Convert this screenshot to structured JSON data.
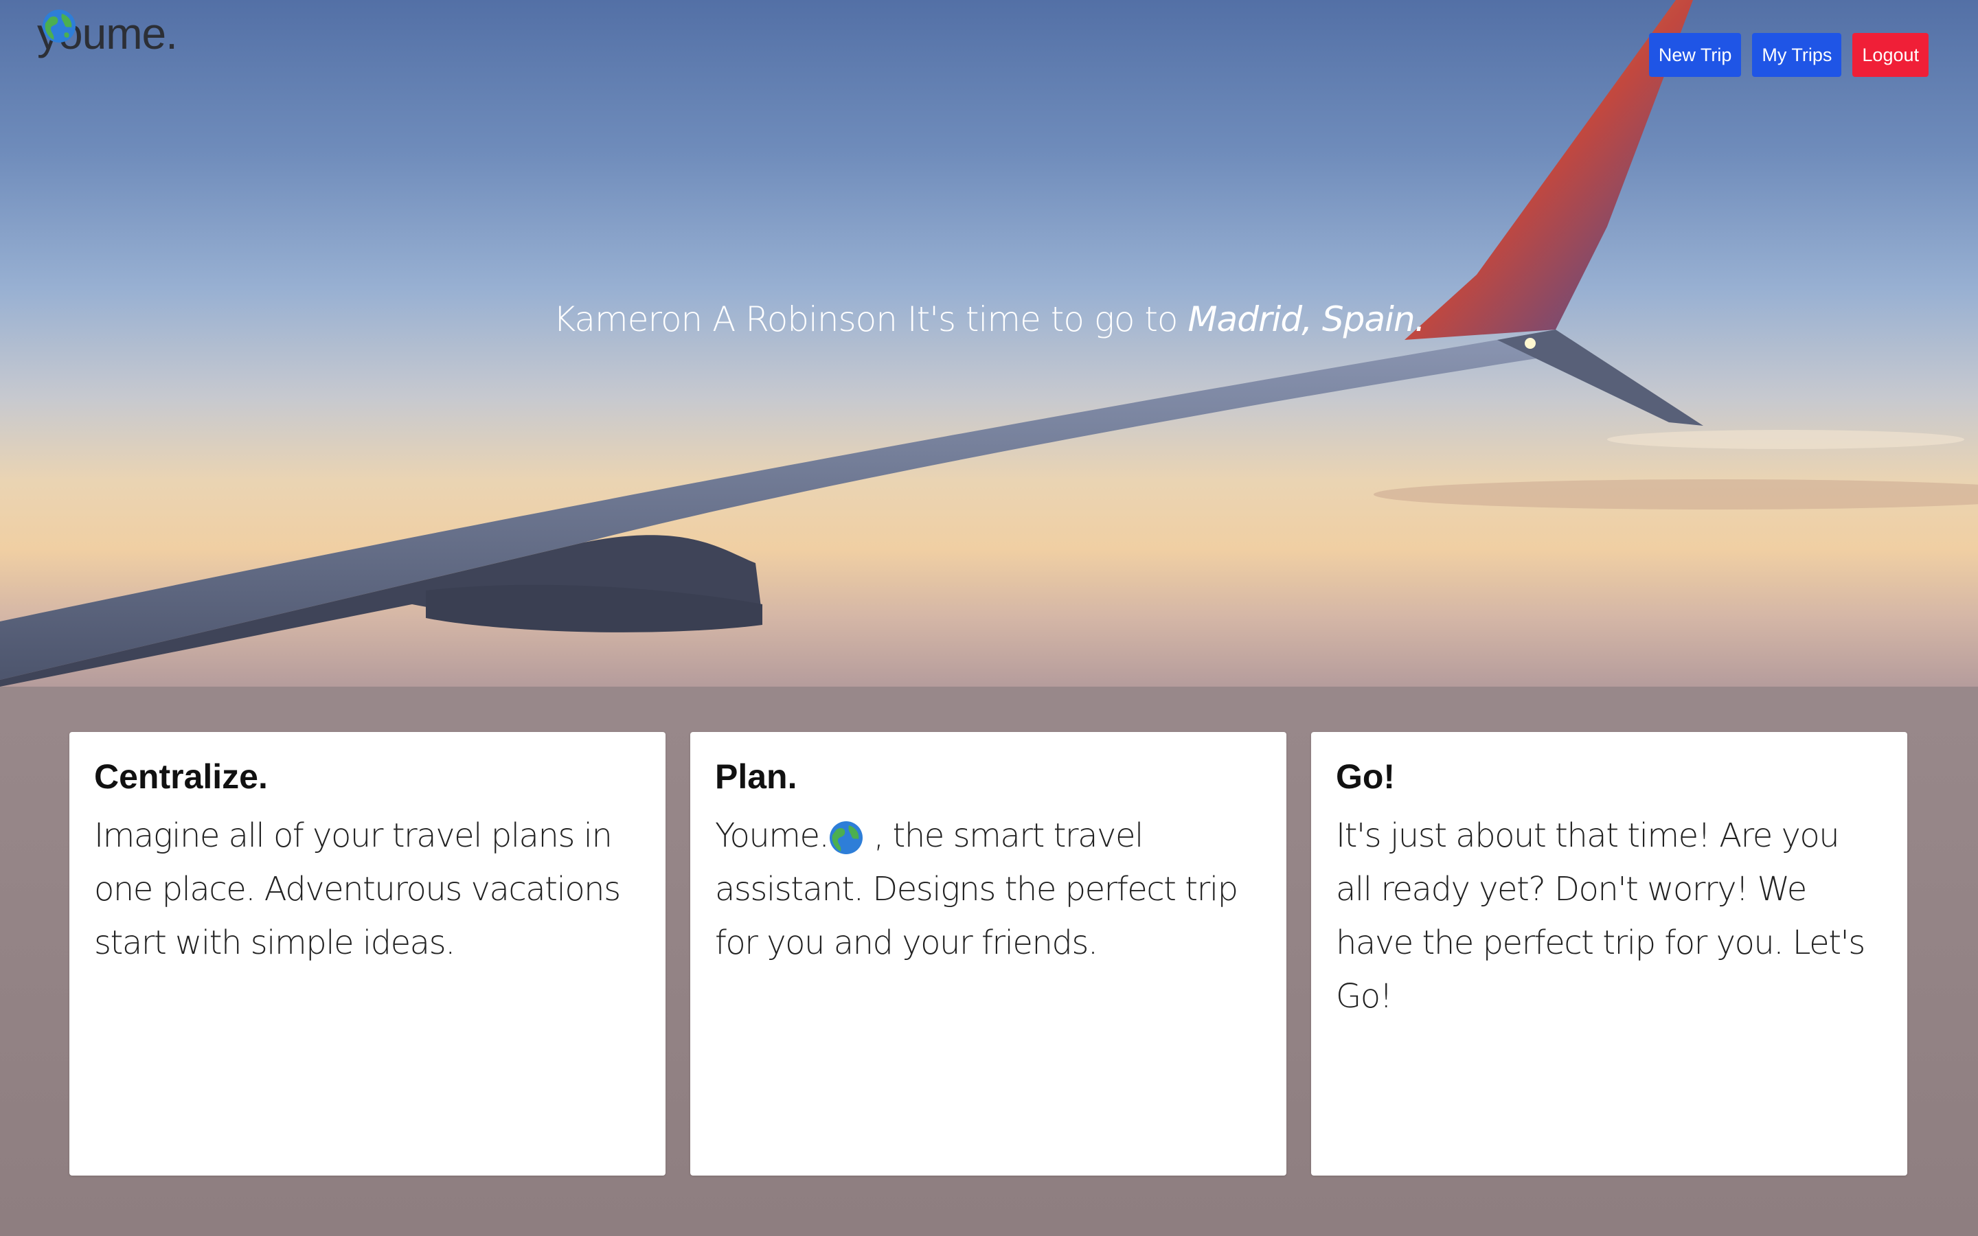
{
  "brand": {
    "name": "youme.",
    "icon": "globe-icon"
  },
  "nav": {
    "new_trip": "New Trip",
    "my_trips": "My Trips",
    "logout": "Logout"
  },
  "hero": {
    "prefix": "Kameron A Robinson It's time to go to ",
    "destination": "Madrid, Spain."
  },
  "cards": [
    {
      "title": "Centralize.",
      "body": "Imagine all of your travel plans in one place. Adventurous vacations start with simple ideas."
    },
    {
      "title": "Plan.",
      "body_prefix": "Youme.",
      "body_suffix": " , the smart travel assistant. Designs the perfect trip for you and your friends."
    },
    {
      "title": "Go!",
      "body": "It's just about that time! Are you all ready yet? Don't worry! We have the perfect trip for you. Let's Go!"
    }
  ],
  "colors": {
    "primary": "#1f55e6",
    "danger": "#f01f37",
    "sky_top": "#5573a7",
    "sky_horizon": "#f3d6a4"
  }
}
